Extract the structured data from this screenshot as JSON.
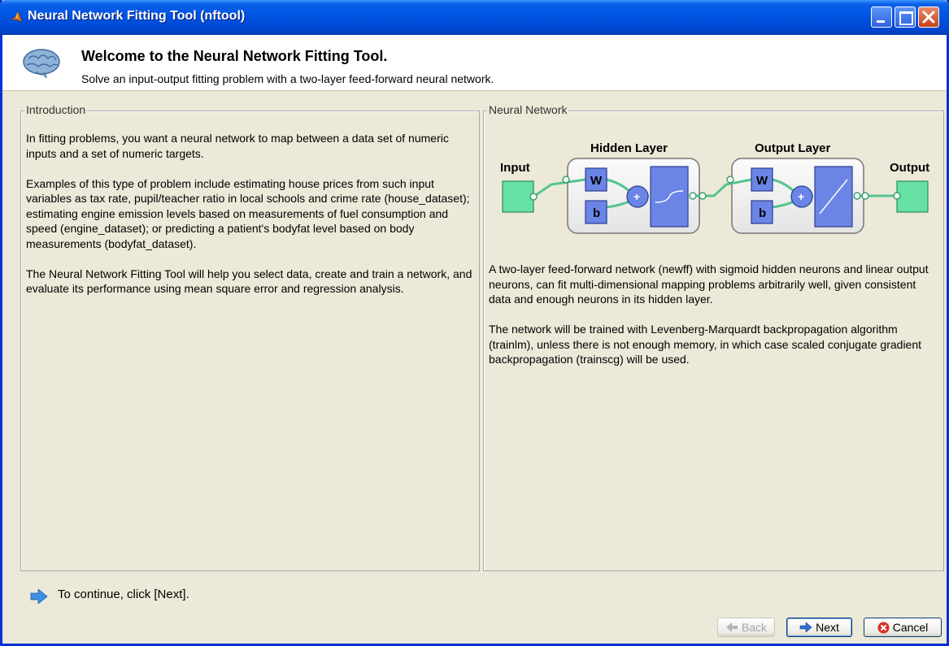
{
  "window": {
    "title": "Neural Network Fitting Tool (nftool)"
  },
  "header": {
    "title": "Welcome to the Neural Network Fitting Tool.",
    "subtitle": "Solve an input-output fitting problem with a two-layer feed-forward neural network."
  },
  "intro": {
    "legend": "Introduction",
    "paragraphs": [
      "In fitting problems, you want a neural network to map between a data set of numeric inputs and a set of numeric targets.",
      "Examples of this type of problem include estimating house prices from such input variables as tax rate, pupil/teacher ratio in local schools and crime rate (house_dataset); estimating engine emission levels based on measurements of fuel consumption and speed (engine_dataset); or predicting a patient's bodyfat level based on body measurements (bodyfat_dataset).",
      "The Neural Network Fitting Tool will help you select data, create and train a network, and evaluate its performance using mean square error and regression analysis."
    ]
  },
  "network": {
    "legend": "Neural Network",
    "diagram": {
      "input_label": "Input",
      "hidden_label": "Hidden Layer",
      "output_layer_label": "Output Layer",
      "output_label": "Output",
      "weight": "W",
      "bias": "b",
      "sum": "+"
    },
    "paragraphs": [
      "A two-layer feed-forward network (newff) with sigmoid hidden neurons and linear output neurons, can fit multi-dimensional mapping problems arbitrarily well, given consistent data and enough neurons in its hidden layer.",
      "The network will be trained with Levenberg-Marquardt backpropagation algorithm (trainlm), unless there is not enough memory, in which case scaled conjugate gradient backpropagation (trainscg) will be used."
    ]
  },
  "footer": {
    "hint": "To continue, click [Next].",
    "back_label": "Back",
    "next_label": "Next",
    "cancel_label": "Cancel"
  },
  "colors": {
    "titlebar": "#0054e3",
    "node_green": "#66e0a3",
    "layer_blue": "#6b85e6",
    "panel_bg": "#ece9d8"
  }
}
